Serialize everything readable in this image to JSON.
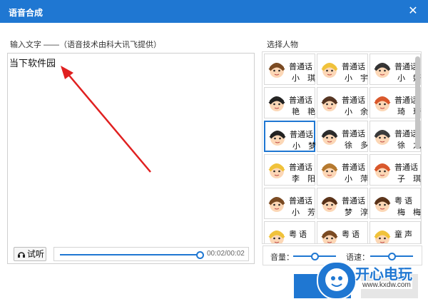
{
  "window": {
    "title": "语音合成",
    "close_glyph": "✕"
  },
  "input_section": {
    "label": "输入文字 ——（语音技术由科大讯飞提供）",
    "text": "当下软件园"
  },
  "playback": {
    "listen_label": "试听",
    "time": "00:02/00:02",
    "progress": 1.0
  },
  "voices": {
    "label": "选择人物",
    "selected": "小 梦",
    "items": [
      {
        "line1": "普通话",
        "line2": "小 琪",
        "face": "girl"
      },
      {
        "line1": "普通话",
        "line2": "小 宇",
        "face": "boy"
      },
      {
        "line1": "普通话",
        "line2": "小 妍",
        "face": "boy-cap"
      },
      {
        "line1": "普通话",
        "line2": "艳 艳",
        "face": "girl-dark"
      },
      {
        "line1": "普通话",
        "line2": "小 余",
        "face": "man-glasses"
      },
      {
        "line1": "普通话",
        "line2": "琦 琦",
        "face": "girl-red"
      },
      {
        "line1": "普通话",
        "line2": "小 梦",
        "face": "girl-dark"
      },
      {
        "line1": "普通话",
        "line2": "徐 多",
        "face": "man-mustache"
      },
      {
        "line1": "普通话",
        "line2": "徐 九",
        "face": "man-hat"
      },
      {
        "line1": "普通话",
        "line2": "李 阳",
        "face": "boy"
      },
      {
        "line1": "普通话",
        "line2": "小 萍",
        "face": "girl-glasses"
      },
      {
        "line1": "普通话",
        "line2": "子 琪",
        "face": "girl-red"
      },
      {
        "line1": "普通话",
        "line2": "小 芳",
        "face": "girl"
      },
      {
        "line1": "普通话",
        "line2": "梦 淳",
        "face": "girl-long"
      },
      {
        "line1": "粤 语",
        "line2": "梅 梅",
        "face": "girl-long"
      },
      {
        "line1": "粤 语",
        "line2": "",
        "face": "boy"
      },
      {
        "line1": "粤 语",
        "line2": "",
        "face": "girl"
      },
      {
        "line1": "童 声",
        "line2": "",
        "face": "boy"
      }
    ]
  },
  "controls": {
    "volume_label": "音量：",
    "speed_label": "语速：",
    "volume": 0.5,
    "speed": 0.5
  },
  "watermark": {
    "title": "开心电玩",
    "url": "www.kxdw.com"
  },
  "colors": {
    "accent": "#1f77d2",
    "arrow": "#e02020"
  }
}
